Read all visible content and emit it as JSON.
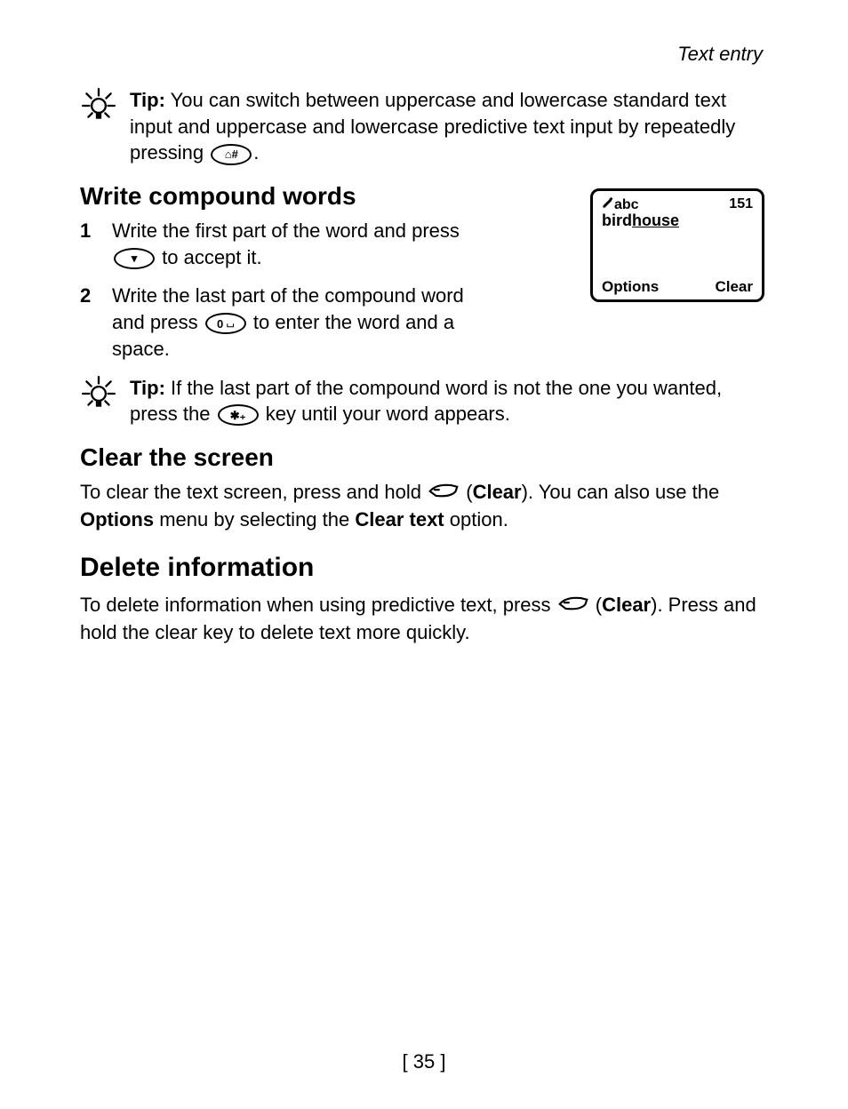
{
  "header": {
    "label": "Text entry"
  },
  "tip1": {
    "label": "Tip:",
    "text_before_key": " You can switch between uppercase and lowercase standard text input and uppercase and lowercase predictive text input by repeatedly pressing ",
    "text_after_key": "."
  },
  "section_compound": {
    "heading": "Write compound words",
    "steps": [
      {
        "num": "1",
        "before": "Write the first part of the word and press ",
        "key": "▾",
        "after": " to accept it."
      },
      {
        "num": "2",
        "before": "Write the last part of the compound word and press ",
        "key": "0 ⏘",
        "after": " to enter the word and a space."
      }
    ]
  },
  "phone": {
    "mode_prefix": ".:≡",
    "mode": "abc",
    "count": "151",
    "word_prefix": "bird",
    "word_underlined": "house",
    "soft_left": "Options",
    "soft_right": "Clear"
  },
  "tip2": {
    "label": "Tip:",
    "before": " If the last part of the compound word is not the one you wanted, press the ",
    "after": " key until your word appears."
  },
  "section_clear": {
    "heading": "Clear the screen",
    "p_before": "To clear the text screen, press and hold ",
    "clear_open": " (",
    "clear_word": "Clear",
    "clear_close": "). You can also use the ",
    "options_word": "Options",
    "p_mid": " menu by selecting the ",
    "cleartext_word": "Clear text",
    "p_after": " option."
  },
  "section_delete": {
    "heading": "Delete information",
    "p_before": "To delete information when using predictive text, press ",
    "clear_open": " (",
    "clear_word": "Clear",
    "clear_close": "). Press and hold the clear key to delete text more quickly."
  },
  "page_number": "[ 35 ]"
}
